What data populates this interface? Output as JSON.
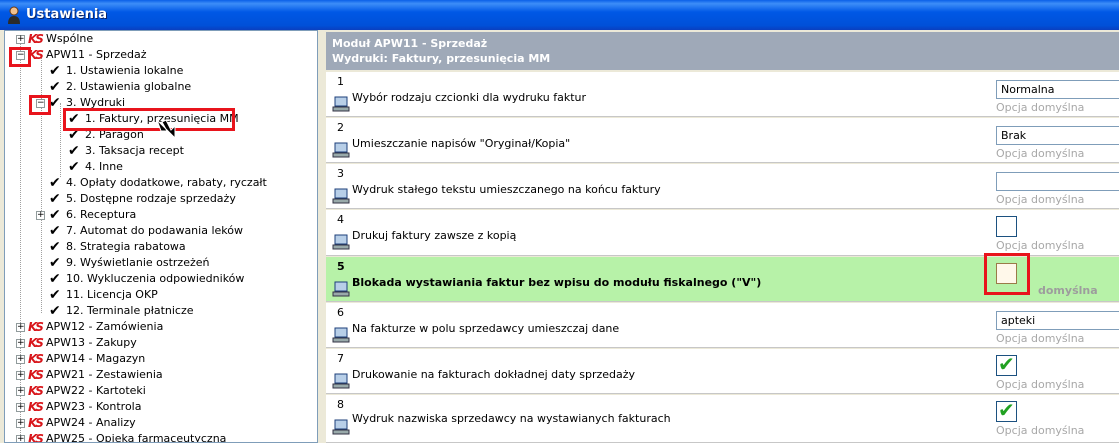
{
  "window": {
    "title": "Ustawienia"
  },
  "tree": {
    "items": [
      {
        "label": "Wspólne"
      },
      {
        "label": "APW11 - Sprzedaż"
      },
      {
        "label": "1. Ustawienia lokalne"
      },
      {
        "label": "2. Ustawienia globalne"
      },
      {
        "label": "3. Wydruki"
      },
      {
        "label": "1. Faktury, przesunięcia MM"
      },
      {
        "label": "2. Paragon"
      },
      {
        "label": "3. Taksacja recept"
      },
      {
        "label": "4. Inne"
      },
      {
        "label": "4. Opłaty dodatkowe, rabaty, ryczałt"
      },
      {
        "label": "5. Dostępne rodzaje sprzedaży"
      },
      {
        "label": "6. Receptura"
      },
      {
        "label": "7. Automat do podawania leków"
      },
      {
        "label": "8. Strategia rabatowa"
      },
      {
        "label": "9. Wyświetlanie ostrzeżeń"
      },
      {
        "label": "10. Wykluczenia odpowiedników"
      },
      {
        "label": "11. Licencja OKP"
      },
      {
        "label": "12. Terminale płatnicze"
      },
      {
        "label": "APW12 - Zamówienia"
      },
      {
        "label": "APW13 - Zakupy"
      },
      {
        "label": "APW14 - Magazyn"
      },
      {
        "label": "APW21 - Zestawienia"
      },
      {
        "label": "APW22 - Kartoteki"
      },
      {
        "label": "APW23 - Kontrola"
      },
      {
        "label": "APW24 - Analizy"
      },
      {
        "label": "APW25 - Opieka farmaceutyczna"
      }
    ],
    "logo_text": "KS"
  },
  "panel": {
    "header_line1": "Moduł APW11 - Sprzedaż",
    "header_line2": "Wydruki: Faktury, przesunięcia MM",
    "default_label": "Opcja domyślna",
    "options": [
      {
        "num": "1",
        "text": "Wybór rodzaju czcionki dla wydruku faktur",
        "value": "Normalna"
      },
      {
        "num": "2",
        "text": "Umieszczanie napisów \"Oryginał/Kopia\"",
        "value": "Brak"
      },
      {
        "num": "3",
        "text": "Wydruk stałego tekstu umieszczanego na końcu faktury",
        "value": ""
      },
      {
        "num": "4",
        "text": "Drukuj faktury zawsze z kopią",
        "checked": false
      },
      {
        "num": "5",
        "text": "Blokada wystawiania faktur bez wpisu do modułu fiskalnego (\"V\")",
        "checked": false,
        "default_partial": "domyślna"
      },
      {
        "num": "6",
        "text": "Na fakturze w polu sprzedawcy umieszczaj dane",
        "value": "apteki"
      },
      {
        "num": "7",
        "text": "Drukowanie na fakturach dokładnej daty sprzedaży",
        "checked": true
      },
      {
        "num": "8",
        "text": "Wydruk nazwiska sprzedawcy na wystawianych fakturach",
        "checked": true
      }
    ]
  },
  "colors": {
    "highlight_row": "#b7f2a8",
    "annotation_red": "#e8141c",
    "titlebar": "#0058e6"
  }
}
